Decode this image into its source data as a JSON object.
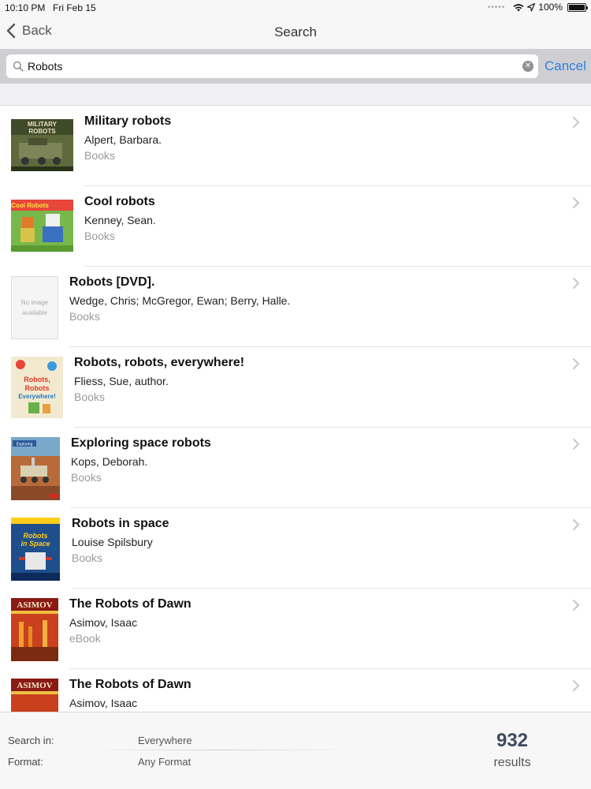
{
  "status": {
    "time": "10:10 PM",
    "date": "Fri Feb 15",
    "battery": "100%"
  },
  "nav": {
    "back_label": "Back",
    "title": "Search"
  },
  "search": {
    "query": "Robots",
    "cancel_label": "Cancel"
  },
  "results": [
    {
      "title": "Military robots",
      "author": "Alpert, Barbara.",
      "format": "Books",
      "cover_text": "MILITARY ROBOTS",
      "cover_color": "#5e6a3c"
    },
    {
      "title": "Cool robots",
      "author": "Kenney, Sean.",
      "format": "Books",
      "cover_text": "Cool Robots",
      "cover_color": "#6fa840"
    },
    {
      "title": "Robots [DVD].",
      "author": "Wedge, Chris; McGregor, Ewan; Berry, Halle.",
      "format": "Books",
      "cover_text": "No image available",
      "cover_color": "#f3f3f3"
    },
    {
      "title": "Robots, robots, everywhere!",
      "author": "Fliess, Sue, author.",
      "format": "Books",
      "cover_text": "Robots, Robots Everywhere!",
      "cover_color": "#f2ead0"
    },
    {
      "title": "Exploring space robots",
      "author": "Kops, Deborah.",
      "format": "Books",
      "cover_text": "Exploring",
      "cover_color": "#a8643a"
    },
    {
      "title": "Robots in space",
      "author": "Louise Spilsbury",
      "format": "Books",
      "cover_text": "Robots in Space",
      "cover_color": "#1f4e8c"
    },
    {
      "title": "The Robots of Dawn",
      "author": "Asimov, Isaac",
      "format": "eBook",
      "cover_text": "ASIMOV",
      "cover_color": "#b8362a"
    },
    {
      "title": "The Robots of Dawn",
      "author": "Asimov, Isaac",
      "format": "",
      "cover_text": "ASIMOV",
      "cover_color": "#b8362a"
    }
  ],
  "footer": {
    "search_in_label": "Search in:",
    "search_in_value": "Everywhere",
    "format_label": "Format:",
    "format_value": "Any Format",
    "count": "932",
    "count_label": "results"
  },
  "colors": {
    "accent": "#2f7fe0",
    "count": "#3d4a5c"
  }
}
